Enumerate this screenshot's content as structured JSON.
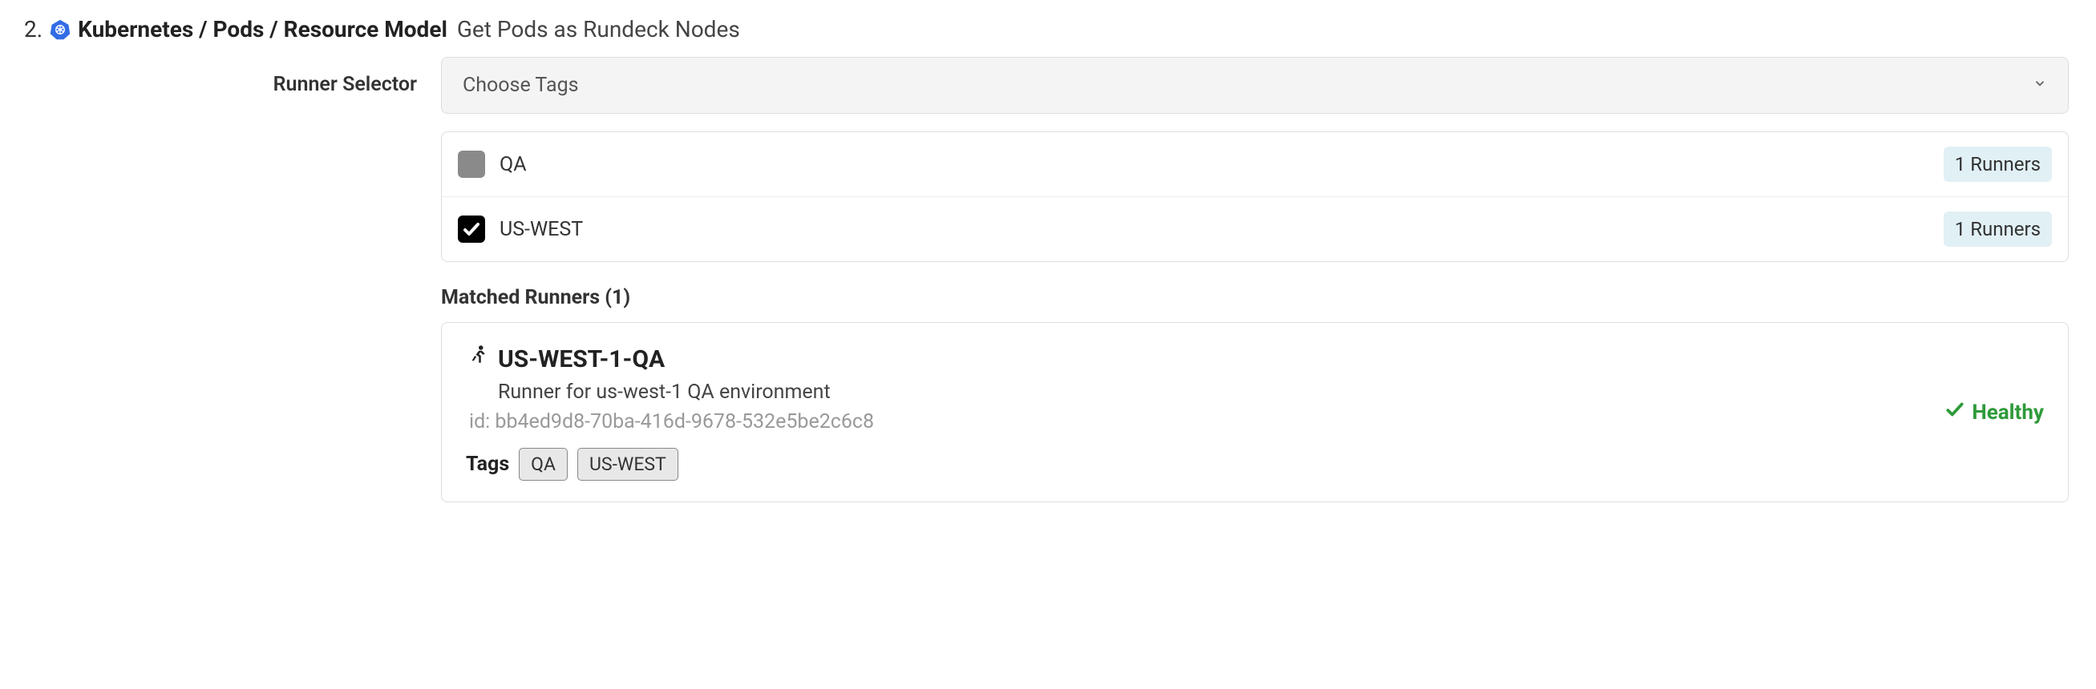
{
  "step": "2.",
  "breadcrumb": {
    "path": "Kubernetes / Pods / Resource Model",
    "desc": "Get Pods as Rundeck Nodes"
  },
  "form": {
    "label": "Runner Selector",
    "dropdown_placeholder": "Choose Tags"
  },
  "tags": [
    {
      "name": "QA",
      "checked": false,
      "count_label": "1 Runners"
    },
    {
      "name": "US-WEST",
      "checked": true,
      "count_label": "1 Runners"
    }
  ],
  "matched": {
    "title": "Matched Runners (1)",
    "runner": {
      "name": "US-WEST-1-QA",
      "desc": "Runner for us-west-1 QA environment",
      "id_line": "id: bb4ed9d8-70ba-416d-9678-532e5be2c6c8",
      "tags_label": "Tags",
      "tags": [
        "QA",
        "US-WEST"
      ],
      "health": "Healthy"
    }
  }
}
